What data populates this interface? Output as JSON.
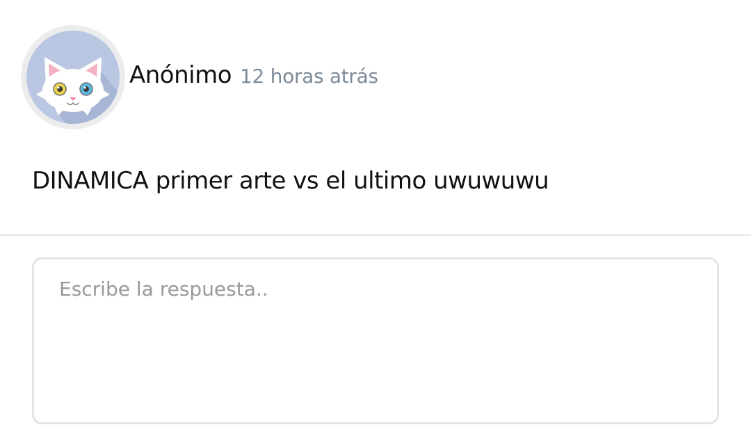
{
  "post": {
    "author": "Anónimo",
    "timestamp": "12 horas atrás",
    "avatar_icon": "cat-avatar-icon",
    "text": "DINAMICA primer arte vs el ultimo uwuwuwu"
  },
  "reply": {
    "placeholder": "Escribe la respuesta..",
    "value": ""
  },
  "colors": {
    "avatar_background": "#b9c7e2",
    "timestamp": "#7c8a98",
    "divider": "#e4e5ea",
    "input_border": "#e3e4e8"
  }
}
